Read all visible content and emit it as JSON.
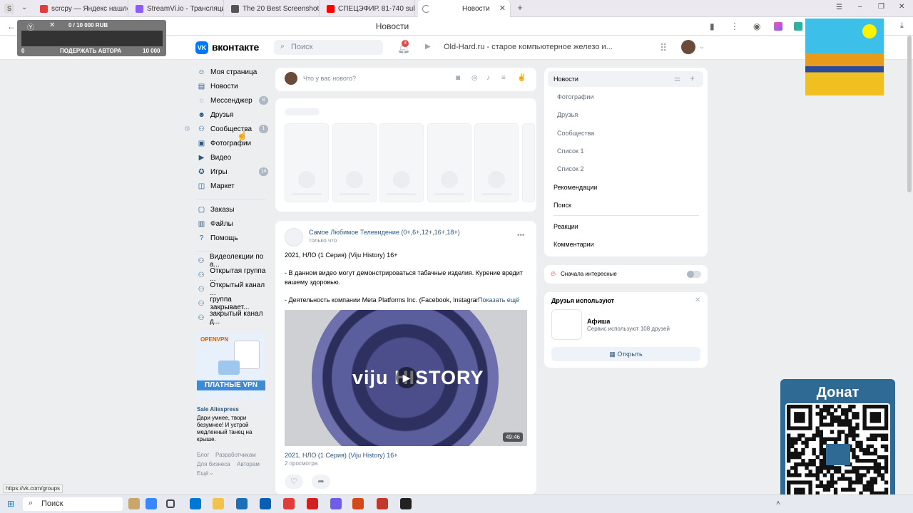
{
  "browser": {
    "tabs": [
      {
        "label": "scrcpy — Яндекс нашлось",
        "color": "#e03c3c"
      },
      {
        "label": "StreamVi.io - Трансляции",
        "color": "#8b5cf6"
      },
      {
        "label": "The 20 Best Screenshot Ap",
        "color": "#555555"
      },
      {
        "label": "СПЕЦЭФИР. 81-740 subt",
        "color": "#ff0000"
      },
      {
        "label": "Новости",
        "color": "#0077ff"
      }
    ],
    "window_title": "Новости",
    "status_url": "https://vk.com/groups"
  },
  "donation_overlay": {
    "amount": "0 / 10 000 RUB",
    "min": "0",
    "label": "ПОДЕРЖАТЬ АВТОРА",
    "max": "10 000",
    "progress": 0
  },
  "header": {
    "logo_letters": "VK",
    "site_name": "вконтакте",
    "search_placeholder": "Поиск",
    "notifications_count": "3",
    "now_playing": "Old-Hard.ru - старое компьютерное железо и..."
  },
  "left_menu": {
    "main": [
      {
        "label": "Моя страница",
        "icon": "user-icon",
        "count": ""
      },
      {
        "label": "Новости",
        "icon": "news-icon",
        "count": ""
      },
      {
        "label": "Мессенджер",
        "icon": "chat-icon",
        "count": "8"
      },
      {
        "label": "Друзья",
        "icon": "friends-icon",
        "count": ""
      },
      {
        "label": "Сообщества",
        "icon": "community-icon",
        "count": "1"
      },
      {
        "label": "Фотографии",
        "icon": "photo-icon",
        "count": ""
      },
      {
        "label": "Видео",
        "icon": "video-icon",
        "count": ""
      },
      {
        "label": "Игры",
        "icon": "game-icon",
        "count": "14"
      },
      {
        "label": "Маркет",
        "icon": "market-icon",
        "count": ""
      }
    ],
    "secondary": [
      {
        "label": "Заказы",
        "icon": "orders-icon"
      },
      {
        "label": "Файлы",
        "icon": "files-icon"
      },
      {
        "label": "Помощь",
        "icon": "help-icon"
      }
    ],
    "groups": [
      "Видеолекции по а...",
      "Открытая группа ...",
      "Открытый канал ...",
      "группа закрывает...",
      "закрытый канал д..."
    ],
    "ad": {
      "brand": "OPENVPN",
      "banner": "ПЛАТНЫЕ VPN",
      "title": "Sale Aliexpress",
      "text": "Дари умнее, твори безумнее! И устрой медленный танец на крыше."
    },
    "footer": {
      "blog": "Блог",
      "developers": "Разработчикам",
      "business": "Для бизнеса",
      "authors": "Авторам",
      "more": "Ещё"
    }
  },
  "composer": {
    "placeholder": "Что у вас нового?"
  },
  "post": {
    "author": "Самое Любимое Телевидение (0+,6+,12+,16+,18+)",
    "time": "только что",
    "title": "2021, НЛО (1 Серия) (Viju History) 16+",
    "para1": "- В данном видео могут демонстрироваться табачные изделия. Курение вредит вашему здоровью.",
    "para2": "- Деятельность компании Meta Platforms Inc. (Facebook, Instagram",
    "show_more": "Показать ещё",
    "video_logo": "viju HISTORY",
    "duration": "49:46",
    "video_caption": "2021, НЛО (1 Серия) (Viju History) 16+",
    "views": "2 просмотра"
  },
  "right_panel": {
    "selected": "Новости",
    "subs": [
      "Фотографии",
      "Друзья",
      "Сообщества",
      "Список 1",
      "Список 2"
    ],
    "items": [
      "Рекомендации",
      "Поиск"
    ],
    "items2": [
      "Реакции",
      "Комментарии"
    ],
    "interesting_first": "Сначала интересные",
    "friends_use_title": "Друзья используют",
    "app_name": "Афиша",
    "app_desc": "Сервис используют 108 друзей",
    "open_button": "Открыть"
  },
  "donate_box": {
    "title": "Донат"
  },
  "taskbar": {
    "search_label": "Поиск"
  }
}
